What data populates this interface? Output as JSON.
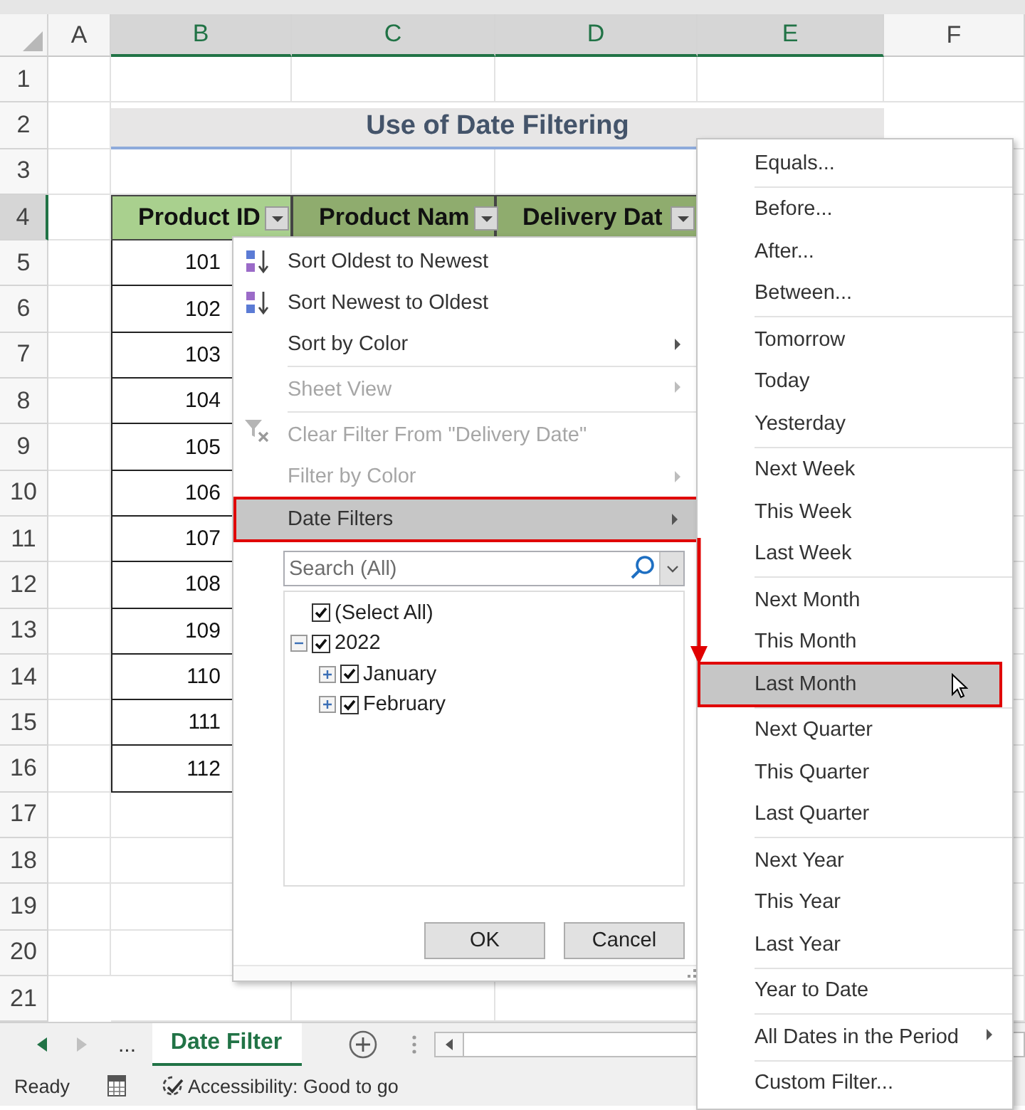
{
  "column_headers": [
    {
      "label": "A",
      "selected": false
    },
    {
      "label": "B",
      "selected": true
    },
    {
      "label": "C",
      "selected": true
    },
    {
      "label": "D",
      "selected": true
    },
    {
      "label": "E",
      "selected": true
    },
    {
      "label": "F",
      "selected": false
    }
  ],
  "row_headers": [
    {
      "label": "1",
      "selected": false
    },
    {
      "label": "2",
      "selected": false
    },
    {
      "label": "3",
      "selected": false
    },
    {
      "label": "4",
      "selected": true
    },
    {
      "label": "5",
      "selected": false
    },
    {
      "label": "6",
      "selected": false
    },
    {
      "label": "7",
      "selected": false
    },
    {
      "label": "8",
      "selected": false
    },
    {
      "label": "9",
      "selected": false
    },
    {
      "label": "10",
      "selected": false
    },
    {
      "label": "11",
      "selected": false
    },
    {
      "label": "12",
      "selected": false
    },
    {
      "label": "13",
      "selected": false
    },
    {
      "label": "14",
      "selected": false
    },
    {
      "label": "15",
      "selected": false
    },
    {
      "label": "16",
      "selected": false
    },
    {
      "label": "17",
      "selected": false
    },
    {
      "label": "18",
      "selected": false
    },
    {
      "label": "19",
      "selected": false
    },
    {
      "label": "20",
      "selected": false
    },
    {
      "label": "21",
      "selected": false
    }
  ],
  "title": "Use of Date Filtering",
  "table": {
    "columns": [
      {
        "label": "Product ID"
      },
      {
        "label": "Product Nam"
      },
      {
        "label": "Delivery Dat"
      }
    ],
    "rows": [
      "101",
      "102",
      "103",
      "104",
      "105",
      "106",
      "107",
      "108",
      "109",
      "110",
      "111",
      "112"
    ]
  },
  "filter_menu": {
    "items": [
      {
        "kind": "sort_up",
        "label": "Sort Oldest to Newest",
        "disabled": false,
        "submenu": false,
        "selected": false,
        "separator_before": false
      },
      {
        "kind": "sort_down",
        "label": "Sort Newest to Oldest",
        "disabled": false,
        "submenu": false,
        "selected": false,
        "separator_before": false
      },
      {
        "kind": "plain",
        "label": "Sort by Color",
        "disabled": false,
        "submenu": true,
        "selected": false,
        "separator_before": false
      },
      {
        "kind": "plain",
        "label": "Sheet View",
        "disabled": true,
        "submenu": true,
        "selected": false,
        "separator_before": true
      },
      {
        "kind": "clear",
        "label": "Clear Filter From \"Delivery Date\"",
        "disabled": true,
        "submenu": false,
        "selected": false,
        "separator_before": true
      },
      {
        "kind": "plain",
        "label": "Filter by Color",
        "disabled": true,
        "submenu": true,
        "selected": false,
        "separator_before": false
      },
      {
        "kind": "plain",
        "label": "Date Filters",
        "disabled": false,
        "submenu": true,
        "selected": true,
        "separator_before": false
      }
    ],
    "search": {
      "placeholder": "Search (All)"
    },
    "tree": [
      {
        "label": "(Select All)",
        "checked": true
      },
      {
        "label": "2022",
        "checked": true,
        "expanded": true,
        "children": [
          {
            "label": "January",
            "checked": true,
            "expanded": false
          },
          {
            "label": "February",
            "checked": true,
            "expanded": false
          }
        ]
      }
    ],
    "buttons": [
      "OK",
      "Cancel"
    ]
  },
  "date_filters_menu": {
    "items": [
      {
        "label": "Equals...",
        "selected": false,
        "separator_before": false,
        "submenu": false
      },
      {
        "label": "Before...",
        "selected": false,
        "separator_before": true,
        "submenu": false
      },
      {
        "label": "After...",
        "selected": false,
        "separator_before": false,
        "submenu": false
      },
      {
        "label": "Between...",
        "selected": false,
        "separator_before": false,
        "submenu": false
      },
      {
        "label": "Tomorrow",
        "selected": false,
        "separator_before": true,
        "submenu": false
      },
      {
        "label": "Today",
        "selected": false,
        "separator_before": false,
        "submenu": false
      },
      {
        "label": "Yesterday",
        "selected": false,
        "separator_before": false,
        "submenu": false
      },
      {
        "label": "Next Week",
        "selected": false,
        "separator_before": true,
        "submenu": false
      },
      {
        "label": "This Week",
        "selected": false,
        "separator_before": false,
        "submenu": false
      },
      {
        "label": "Last Week",
        "selected": false,
        "separator_before": false,
        "submenu": false
      },
      {
        "label": "Next Month",
        "selected": false,
        "separator_before": true,
        "submenu": false
      },
      {
        "label": "This Month",
        "selected": false,
        "separator_before": false,
        "submenu": false
      },
      {
        "label": "Last Month",
        "selected": true,
        "separator_before": false,
        "submenu": false
      },
      {
        "label": "Next Quarter",
        "selected": false,
        "separator_before": true,
        "submenu": false
      },
      {
        "label": "This Quarter",
        "selected": false,
        "separator_before": false,
        "submenu": false
      },
      {
        "label": "Last Quarter",
        "selected": false,
        "separator_before": false,
        "submenu": false
      },
      {
        "label": "Next Year",
        "selected": false,
        "separator_before": true,
        "submenu": false
      },
      {
        "label": "This Year",
        "selected": false,
        "separator_before": false,
        "submenu": false
      },
      {
        "label": "Last Year",
        "selected": false,
        "separator_before": false,
        "submenu": false
      },
      {
        "label": "Year to Date",
        "selected": false,
        "separator_before": true,
        "submenu": false
      },
      {
        "label": "All Dates in the Period",
        "selected": false,
        "separator_before": true,
        "submenu": true
      },
      {
        "label": "Custom Filter...",
        "selected": false,
        "separator_before": true,
        "submenu": false
      }
    ]
  },
  "sheet_tabs": {
    "more": "...",
    "tabs": [
      {
        "label": "Date Filter",
        "selected": true
      }
    ]
  },
  "status_bar": {
    "mode": "Ready",
    "accessibility": "Accessibility: Good to go"
  }
}
